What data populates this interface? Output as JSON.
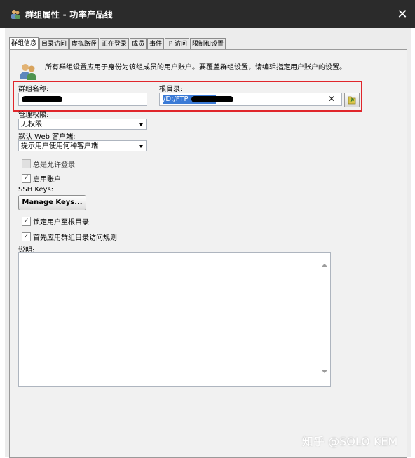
{
  "window": {
    "title": "群组属性 - 功率产品线",
    "app_icon": "group-users-icon",
    "close_icon": "close-icon",
    "close_glyph": "✕"
  },
  "tabs": [
    {
      "label": "群组信息",
      "active": true
    },
    {
      "label": "目录访问",
      "active": false
    },
    {
      "label": "虚拟路径",
      "active": false
    },
    {
      "label": "正在登录",
      "active": false
    },
    {
      "label": "成员",
      "active": false
    },
    {
      "label": "事件",
      "active": false
    },
    {
      "label": "IP 访问",
      "active": false
    },
    {
      "label": "限制和设置",
      "active": false
    }
  ],
  "info": {
    "icon": "group-users-icon",
    "text": "所有群组设置应用于身份为该组成员的用户账户。要覆盖群组设置，请编辑指定用户账户的设置。"
  },
  "group_name": {
    "label": "群组名称:",
    "value_redacted": true
  },
  "root_dir": {
    "label": "根目录:",
    "value_visible": "/D:/FTP",
    "value_redacted": true,
    "clear_glyph": "✕",
    "browse_icon": "folder-browse-icon"
  },
  "admin_permission": {
    "label": "管理权限:",
    "selected": "无权限"
  },
  "web_client": {
    "label": "默认 Web 客户端:",
    "selected": "提示用户使用何种客户端"
  },
  "checkboxes": [
    {
      "label": "总是允许登录",
      "checked": false,
      "disabled": true
    },
    {
      "label": "启用账户",
      "checked": true,
      "disabled": false
    }
  ],
  "ssh": {
    "label": "SSH Keys:",
    "button": "Manage Keys..."
  },
  "checkboxes2": [
    {
      "label": "锁定用户至根目录",
      "checked": true
    },
    {
      "label": "首先应用群组目录访问规则",
      "checked": true
    }
  ],
  "description": {
    "label": "说明:",
    "value": ""
  },
  "check_glyph": "✓",
  "watermark": "知乎 @SOLO KEM",
  "colors": {
    "highlight_box": "#e0262b",
    "selection": "#3a7ad6",
    "titlebar": "#2b2b2b"
  }
}
